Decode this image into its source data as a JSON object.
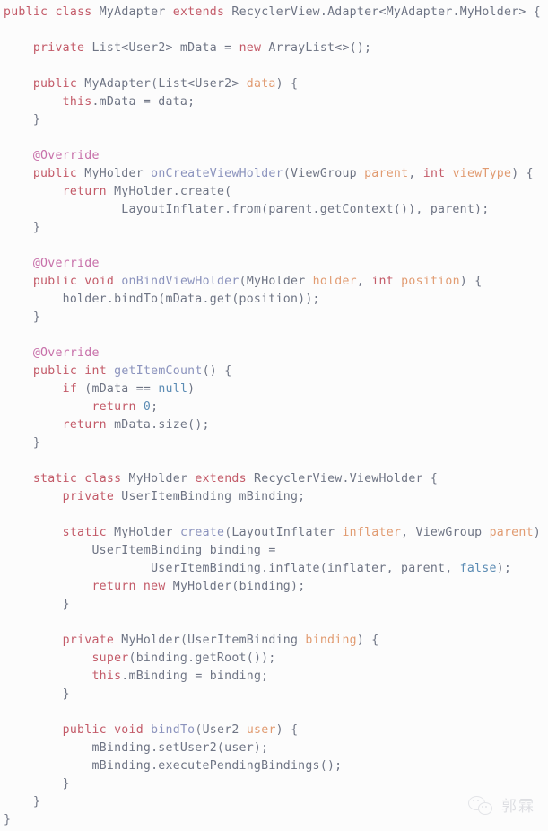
{
  "editor": {
    "language": "java",
    "background_color": "#fcfcfc",
    "font_size_px": 13,
    "line_height_px": 20,
    "colors": {
      "keyword": "#c35a68",
      "identifier": "#6e7484",
      "method": "#8b93bd",
      "parameter": "#e19b71",
      "literal": "#5c8cb4",
      "annotation": "#c76fa9",
      "punctuation": "#7a7f8d"
    },
    "lines": [
      {
        "indent": 0,
        "tokens": [
          {
            "t": "public",
            "c": "kw"
          },
          {
            "t": " ",
            "c": "pun"
          },
          {
            "t": "class",
            "c": "kw"
          },
          {
            "t": " ",
            "c": "pun"
          },
          {
            "t": "MyAdapter",
            "c": "id"
          },
          {
            "t": " ",
            "c": "pun"
          },
          {
            "t": "extends",
            "c": "kw"
          },
          {
            "t": " ",
            "c": "pun"
          },
          {
            "t": "RecyclerView.Adapter<MyAdapter.MyHolder> {",
            "c": "id"
          }
        ]
      },
      {
        "indent": 0,
        "tokens": []
      },
      {
        "indent": 1,
        "tokens": [
          {
            "t": "private",
            "c": "kw"
          },
          {
            "t": " ",
            "c": "pun"
          },
          {
            "t": "List<User2> mData = ",
            "c": "id"
          },
          {
            "t": "new",
            "c": "kw"
          },
          {
            "t": " ",
            "c": "pun"
          },
          {
            "t": "ArrayList<>();",
            "c": "id"
          }
        ]
      },
      {
        "indent": 0,
        "tokens": []
      },
      {
        "indent": 1,
        "tokens": [
          {
            "t": "public",
            "c": "kw"
          },
          {
            "t": " ",
            "c": "pun"
          },
          {
            "t": "MyAdapter",
            "c": "id"
          },
          {
            "t": "(",
            "c": "pun"
          },
          {
            "t": "List<User2> ",
            "c": "id"
          },
          {
            "t": "data",
            "c": "par"
          },
          {
            "t": ") {",
            "c": "id"
          }
        ]
      },
      {
        "indent": 2,
        "tokens": [
          {
            "t": "this",
            "c": "kw"
          },
          {
            "t": ".mData = data;",
            "c": "id"
          }
        ]
      },
      {
        "indent": 1,
        "tokens": [
          {
            "t": "}",
            "c": "id"
          }
        ]
      },
      {
        "indent": 0,
        "tokens": []
      },
      {
        "indent": 1,
        "tokens": [
          {
            "t": "@Override",
            "c": "ann"
          }
        ]
      },
      {
        "indent": 1,
        "tokens": [
          {
            "t": "public",
            "c": "kw"
          },
          {
            "t": " ",
            "c": "pun"
          },
          {
            "t": "MyHolder",
            "c": "id"
          },
          {
            "t": " ",
            "c": "pun"
          },
          {
            "t": "onCreateViewHolder",
            "c": "fn"
          },
          {
            "t": "(",
            "c": "pun"
          },
          {
            "t": "ViewGroup ",
            "c": "id"
          },
          {
            "t": "parent",
            "c": "par"
          },
          {
            "t": ", ",
            "c": "id"
          },
          {
            "t": "int",
            "c": "kw"
          },
          {
            "t": " ",
            "c": "pun"
          },
          {
            "t": "viewType",
            "c": "par"
          },
          {
            "t": ") {",
            "c": "id"
          }
        ]
      },
      {
        "indent": 2,
        "tokens": [
          {
            "t": "return",
            "c": "kw"
          },
          {
            "t": " ",
            "c": "pun"
          },
          {
            "t": "MyHolder.create(",
            "c": "id"
          }
        ]
      },
      {
        "indent": 4,
        "tokens": [
          {
            "t": "LayoutInflater.from(parent.getContext()), parent);",
            "c": "id"
          }
        ]
      },
      {
        "indent": 1,
        "tokens": [
          {
            "t": "}",
            "c": "id"
          }
        ]
      },
      {
        "indent": 0,
        "tokens": []
      },
      {
        "indent": 1,
        "tokens": [
          {
            "t": "@Override",
            "c": "ann"
          }
        ]
      },
      {
        "indent": 1,
        "tokens": [
          {
            "t": "public",
            "c": "kw"
          },
          {
            "t": " ",
            "c": "pun"
          },
          {
            "t": "void",
            "c": "kw"
          },
          {
            "t": " ",
            "c": "pun"
          },
          {
            "t": "onBindViewHolder",
            "c": "fn"
          },
          {
            "t": "(",
            "c": "pun"
          },
          {
            "t": "MyHolder ",
            "c": "id"
          },
          {
            "t": "holder",
            "c": "par"
          },
          {
            "t": ", ",
            "c": "id"
          },
          {
            "t": "int",
            "c": "kw"
          },
          {
            "t": " ",
            "c": "pun"
          },
          {
            "t": "position",
            "c": "par"
          },
          {
            "t": ") {",
            "c": "id"
          }
        ]
      },
      {
        "indent": 2,
        "tokens": [
          {
            "t": "holder.bindTo(mData.get(position));",
            "c": "id"
          }
        ]
      },
      {
        "indent": 1,
        "tokens": [
          {
            "t": "}",
            "c": "id"
          }
        ]
      },
      {
        "indent": 0,
        "tokens": []
      },
      {
        "indent": 1,
        "tokens": [
          {
            "t": "@Override",
            "c": "ann"
          }
        ]
      },
      {
        "indent": 1,
        "tokens": [
          {
            "t": "public",
            "c": "kw"
          },
          {
            "t": " ",
            "c": "pun"
          },
          {
            "t": "int",
            "c": "kw"
          },
          {
            "t": " ",
            "c": "pun"
          },
          {
            "t": "getItemCount",
            "c": "fn"
          },
          {
            "t": "() {",
            "c": "id"
          }
        ]
      },
      {
        "indent": 2,
        "tokens": [
          {
            "t": "if",
            "c": "kw"
          },
          {
            "t": " ",
            "c": "pun"
          },
          {
            "t": "(mData == ",
            "c": "id"
          },
          {
            "t": "null",
            "c": "lit"
          },
          {
            "t": ")",
            "c": "id"
          }
        ]
      },
      {
        "indent": 3,
        "tokens": [
          {
            "t": "return",
            "c": "kw"
          },
          {
            "t": " ",
            "c": "pun"
          },
          {
            "t": "0",
            "c": "lit"
          },
          {
            "t": ";",
            "c": "id"
          }
        ]
      },
      {
        "indent": 2,
        "tokens": [
          {
            "t": "return",
            "c": "kw"
          },
          {
            "t": " ",
            "c": "pun"
          },
          {
            "t": "mData.size();",
            "c": "id"
          }
        ]
      },
      {
        "indent": 1,
        "tokens": [
          {
            "t": "}",
            "c": "id"
          }
        ]
      },
      {
        "indent": 0,
        "tokens": []
      },
      {
        "indent": 1,
        "tokens": [
          {
            "t": "static",
            "c": "kw"
          },
          {
            "t": " ",
            "c": "pun"
          },
          {
            "t": "class",
            "c": "kw"
          },
          {
            "t": " ",
            "c": "pun"
          },
          {
            "t": "MyHolder",
            "c": "id"
          },
          {
            "t": " ",
            "c": "pun"
          },
          {
            "t": "extends",
            "c": "kw"
          },
          {
            "t": " ",
            "c": "pun"
          },
          {
            "t": "RecyclerView.ViewHolder {",
            "c": "id"
          }
        ]
      },
      {
        "indent": 2,
        "tokens": [
          {
            "t": "private",
            "c": "kw"
          },
          {
            "t": " ",
            "c": "pun"
          },
          {
            "t": "UserItemBinding mBinding;",
            "c": "id"
          }
        ]
      },
      {
        "indent": 0,
        "tokens": []
      },
      {
        "indent": 2,
        "tokens": [
          {
            "t": "static",
            "c": "kw"
          },
          {
            "t": " ",
            "c": "pun"
          },
          {
            "t": "MyHolder",
            "c": "id"
          },
          {
            "t": " ",
            "c": "pun"
          },
          {
            "t": "create",
            "c": "fn"
          },
          {
            "t": "(",
            "c": "pun"
          },
          {
            "t": "LayoutInflater ",
            "c": "id"
          },
          {
            "t": "inflater",
            "c": "par"
          },
          {
            "t": ", ViewGroup ",
            "c": "id"
          },
          {
            "t": "parent",
            "c": "par"
          },
          {
            "t": ") {",
            "c": "id"
          }
        ]
      },
      {
        "indent": 3,
        "tokens": [
          {
            "t": "UserItemBinding binding =",
            "c": "id"
          }
        ]
      },
      {
        "indent": 5,
        "tokens": [
          {
            "t": "UserItemBinding.inflate(inflater, parent, ",
            "c": "id"
          },
          {
            "t": "false",
            "c": "lit"
          },
          {
            "t": ");",
            "c": "id"
          }
        ]
      },
      {
        "indent": 3,
        "tokens": [
          {
            "t": "return",
            "c": "kw"
          },
          {
            "t": " ",
            "c": "pun"
          },
          {
            "t": "new",
            "c": "kw"
          },
          {
            "t": " ",
            "c": "pun"
          },
          {
            "t": "MyHolder(binding);",
            "c": "id"
          }
        ]
      },
      {
        "indent": 2,
        "tokens": [
          {
            "t": "}",
            "c": "id"
          }
        ]
      },
      {
        "indent": 0,
        "tokens": []
      },
      {
        "indent": 2,
        "tokens": [
          {
            "t": "private",
            "c": "kw"
          },
          {
            "t": " ",
            "c": "pun"
          },
          {
            "t": "MyHolder",
            "c": "id"
          },
          {
            "t": "(",
            "c": "pun"
          },
          {
            "t": "UserItemBinding ",
            "c": "id"
          },
          {
            "t": "binding",
            "c": "par"
          },
          {
            "t": ") {",
            "c": "id"
          }
        ]
      },
      {
        "indent": 3,
        "tokens": [
          {
            "t": "super",
            "c": "kw"
          },
          {
            "t": "(binding.getRoot());",
            "c": "id"
          }
        ]
      },
      {
        "indent": 3,
        "tokens": [
          {
            "t": "this",
            "c": "kw"
          },
          {
            "t": ".mBinding = binding;",
            "c": "id"
          }
        ]
      },
      {
        "indent": 2,
        "tokens": [
          {
            "t": "}",
            "c": "id"
          }
        ]
      },
      {
        "indent": 0,
        "tokens": []
      },
      {
        "indent": 2,
        "tokens": [
          {
            "t": "public",
            "c": "kw"
          },
          {
            "t": " ",
            "c": "pun"
          },
          {
            "t": "void",
            "c": "kw"
          },
          {
            "t": " ",
            "c": "pun"
          },
          {
            "t": "bindTo",
            "c": "fn"
          },
          {
            "t": "(",
            "c": "pun"
          },
          {
            "t": "User2 ",
            "c": "id"
          },
          {
            "t": "user",
            "c": "par"
          },
          {
            "t": ") {",
            "c": "id"
          }
        ]
      },
      {
        "indent": 3,
        "tokens": [
          {
            "t": "mBinding.setUser2(user);",
            "c": "id"
          }
        ]
      },
      {
        "indent": 3,
        "tokens": [
          {
            "t": "mBinding.executePendingBindings();",
            "c": "id"
          }
        ]
      },
      {
        "indent": 2,
        "tokens": [
          {
            "t": "}",
            "c": "id"
          }
        ]
      },
      {
        "indent": 1,
        "tokens": [
          {
            "t": "}",
            "c": "id"
          }
        ]
      },
      {
        "indent": 0,
        "tokens": [
          {
            "t": "}",
            "c": "id"
          }
        ]
      }
    ]
  },
  "watermark": {
    "icon": "wechat-logo-icon",
    "text": "郭霖"
  }
}
